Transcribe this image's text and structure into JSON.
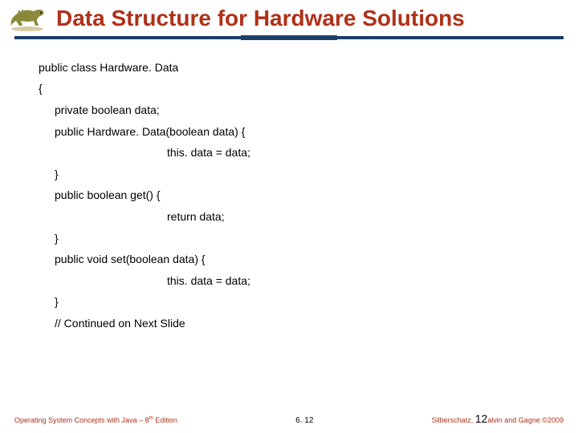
{
  "title": "Data Structure for Hardware Solutions",
  "code": {
    "l1": "public class Hardware. Data",
    "l2": "{",
    "l3": "private boolean data;",
    "l4": "public Hardware. Data(boolean data) {",
    "l5": "this. data = data;",
    "l6": "}",
    "l7": "public boolean get() {",
    "l8": "return data;",
    "l9": "}",
    "l10": "public void set(boolean data) {",
    "l11": "this. data = data;",
    "l12": "}",
    "l13": "// Continued on Next Slide"
  },
  "footer": {
    "left_a": "Operating System Concepts with Java – 8",
    "left_sup": "th",
    "left_b": " Edition",
    "center": "6. 12",
    "right_a": "Silberschatz, Galvin and Gagne ©2009",
    "pagenum": "12"
  }
}
